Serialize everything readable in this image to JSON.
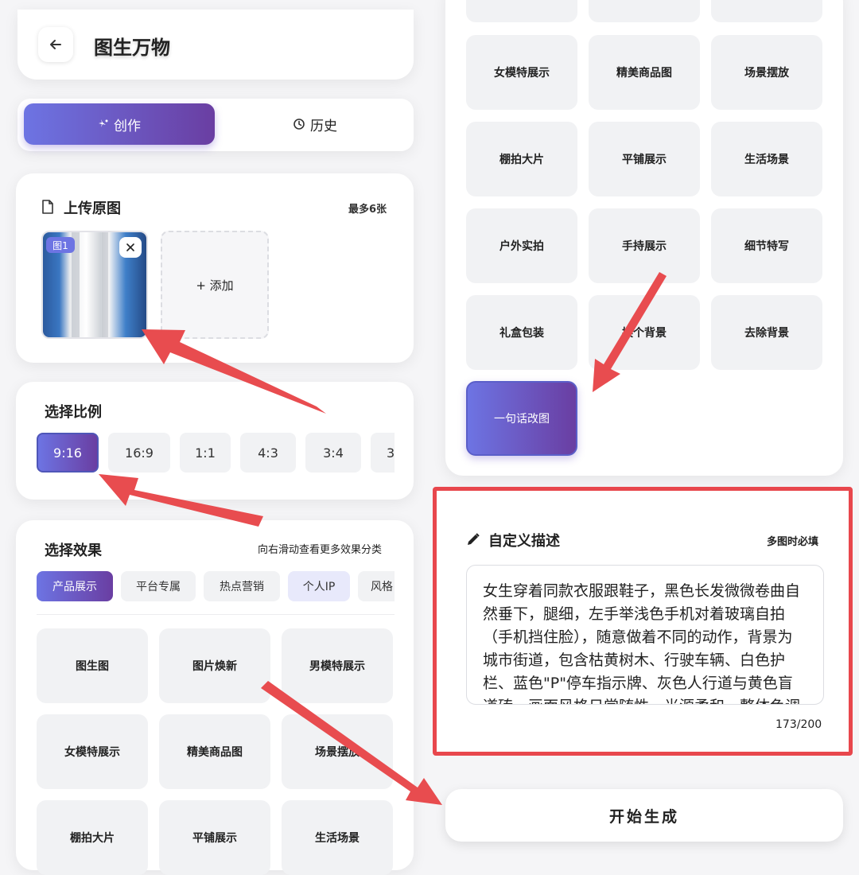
{
  "header": {
    "title": "图生万物"
  },
  "tabs": [
    {
      "label": "创作",
      "active": true
    },
    {
      "label": "历史",
      "active": false
    }
  ],
  "upload": {
    "title": "上传原图",
    "limit": "最多6张",
    "images": [
      {
        "badge": "图1"
      }
    ],
    "add_label": "+ 添加"
  },
  "ratio": {
    "title": "选择比例",
    "options": [
      "9:16",
      "16:9",
      "1:1",
      "4:3",
      "3:4",
      "3"
    ],
    "selected": "9:16"
  },
  "effects": {
    "title": "选择效果",
    "hint": "向右滑动查看更多效果分类",
    "categories": [
      "产品展示",
      "平台专属",
      "热点营销",
      "个人IP",
      "风格"
    ],
    "active_category": "产品展示",
    "items_left": [
      "图生图",
      "图片焕新",
      "男模特展示",
      "女模特展示",
      "精美商品图",
      "场景摆放",
      "棚拍大片",
      "平铺展示",
      "生活场景"
    ],
    "items_right": [
      "女模特展示",
      "精美商品图",
      "场景摆放",
      "棚拍大片",
      "平铺展示",
      "生活场景",
      "户外实拍",
      "手持展示",
      "细节特写",
      "礼盒包装",
      "换个背景",
      "去除背景",
      "一句话改图"
    ],
    "selected_right": "一句话改图"
  },
  "custom": {
    "title": "自定义描述",
    "note": "多图时必填",
    "text": "女生穿着同款衣服跟鞋子，黑色长发微微卷曲自然垂下，腿细，左手举浅色手机对着玻璃自拍（手机挡住脸），随意做着不同的动作，背景为城市街道，包含枯黄树木、行驶车辆、白色护栏、蓝色\"P\"停车指示牌、灰色人行道与黄色盲道砖。画面风格日常随性，光源柔和，整体色调偏冷，真实自然感强，街拍风格",
    "count": "173/200"
  },
  "generate": {
    "label": "开始生成"
  },
  "colors": {
    "accent_start": "#6d74e3",
    "accent_end": "#6a3ea2",
    "annotation": "#e84c4f",
    "annotation_box": "#e8474d"
  }
}
